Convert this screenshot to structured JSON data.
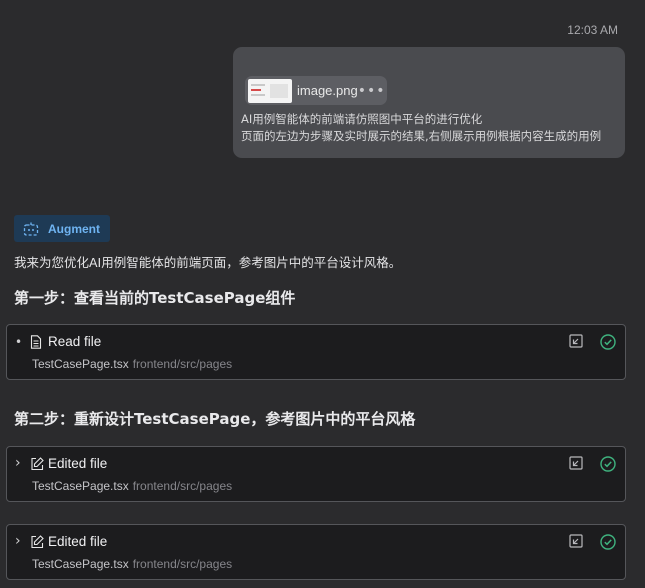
{
  "header": {
    "timestamp": "12:03 AM"
  },
  "user_message": {
    "attachment": {
      "name": "image.png",
      "menu_icon": "more-icon"
    },
    "lines": [
      "AI用例智能体的前端请仿照图中平台的进行优化",
      "页面的左边为步骤及实时展示的结果,右侧展示用例根据内容生成的用例"
    ]
  },
  "agent": {
    "badge_label": "Augment",
    "intro": "我来为您优化AI用例智能体的前端页面，参考图片中的平台设计风格。",
    "steps": [
      "第一步：查看当前的TestCasePage组件",
      "第二步：重新设计TestCasePage，参考图片中的平台风格"
    ],
    "cards": [
      {
        "lead": "•",
        "icon": "file-icon",
        "title": "Read file",
        "file": "TestCasePage.tsx",
        "path": "frontend/src/pages"
      },
      {
        "lead": "›",
        "icon": "edit-icon",
        "title": "Edited file",
        "file": "TestCasePage.tsx",
        "path": "frontend/src/pages"
      },
      {
        "lead": "›",
        "icon": "edit-icon",
        "title": "Edited file",
        "file": "TestCasePage.tsx",
        "path": "frontend/src/pages"
      }
    ]
  },
  "colors": {
    "background": "#2b2b2d",
    "user_bubble": "#4a4b4f",
    "badge_bg": "#1e3a55",
    "badge_text": "#6fb4f2",
    "success": "#3fb37f"
  }
}
